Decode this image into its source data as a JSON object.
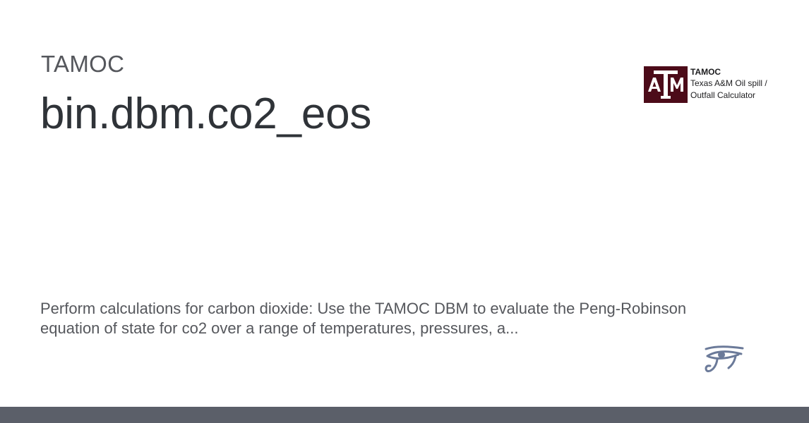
{
  "project": "TAMOC",
  "title": "bin.dbm.co2_eos",
  "description": "Perform calculations for carbon dioxide: Use the TAMOC DBM to evaluate the Peng-Robinson equation of state for co2 over a range of temperatures, pressures, a...",
  "logo": {
    "mark_text": "ATM",
    "name": "TAMOC",
    "tagline_line1": "Texas A&M Oil spill /",
    "tagline_line2": "Outfall Calculator",
    "icon": "texas-am-logo-icon",
    "color": "#4c0b19"
  },
  "site_icon": "eye-of-horus-icon",
  "colors": {
    "footer_bar": "#5b5f69",
    "eye_icon": "#6b7a99"
  }
}
